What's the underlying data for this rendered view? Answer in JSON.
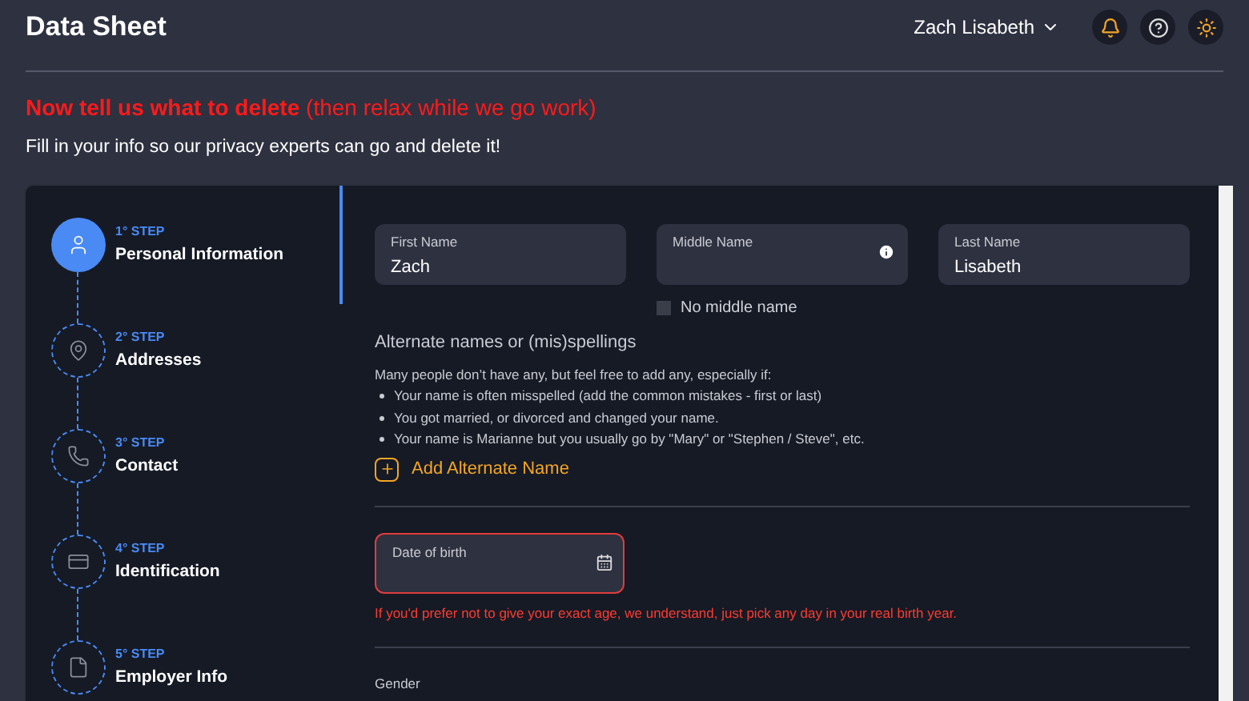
{
  "header": {
    "title": "Data Sheet",
    "user_name": "Zach Lisabeth"
  },
  "intro": {
    "headline_bold": "Now tell us what to delete",
    "headline_rest": "(then relax while we go work)",
    "subtitle": "Fill in your info so our privacy experts can go and delete it!"
  },
  "steps": [
    {
      "number": "1° STEP",
      "label": "Personal Information",
      "selected": true
    },
    {
      "number": "2° STEP",
      "label": "Addresses",
      "selected": false
    },
    {
      "number": "3° STEP",
      "label": "Contact",
      "selected": false
    },
    {
      "number": "4° STEP",
      "label": "Identification",
      "selected": false
    },
    {
      "number": "5° STEP",
      "label": "Employer Info",
      "selected": false
    }
  ],
  "name_fields": [
    {
      "label": "First Name",
      "value": "Zach",
      "info": false
    },
    {
      "label": "Middle Name",
      "info": true
    },
    {
      "label": "Last Name",
      "value": "Lisabeth",
      "info": false
    }
  ],
  "no_middle_name": {
    "label": "No middle name",
    "checked": false
  },
  "alternate_names": {
    "title": "Alternate names or (mis)spellings",
    "intro": "Many people don’t have any, but feel free to add any, especially if:",
    "bullets": [
      "Your name is often misspelled (add the common mistakes - first or last)",
      "You got married, or divorced and changed your name.",
      "Your name is Marianne but you usually go by \"Mary\" or \"Stephen / Steve\", etc."
    ],
    "add_button": "Add Alternate Name"
  },
  "date_of_birth": {
    "label": "Date of birth",
    "error": true,
    "hint": "If you'd prefer not to give your exact age, we understand, just pick any day in your real birth year."
  },
  "gender": {
    "label": "Gender"
  }
}
